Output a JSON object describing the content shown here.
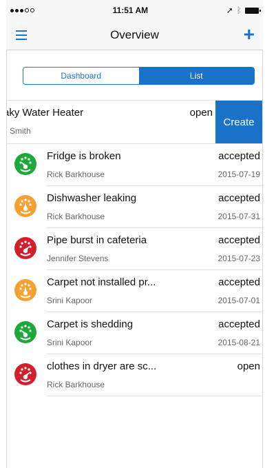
{
  "status_bar": {
    "time": "11:51 AM"
  },
  "nav": {
    "title": "Overview",
    "menu_icon": "hamburger-menu-icon",
    "add_icon": "plus-icon"
  },
  "segmented": {
    "options": [
      "Dashboard",
      "List"
    ],
    "selected": "List"
  },
  "swiped_row": {
    "title": "aky Water Heater",
    "subtitle": "n Smith",
    "status": "open",
    "action": "Create"
  },
  "items": [
    {
      "title": "Fridge is broken",
      "assignee": "Rick Barkhouse",
      "status": "accepted",
      "date": "2015-07-19",
      "priority": "green"
    },
    {
      "title": "Dishwasher leaking",
      "assignee": "Rick Barkhouse",
      "status": "accepted",
      "date": "2015-07-31",
      "priority": "orange"
    },
    {
      "title": "Pipe burst in cafeteria",
      "assignee": "Jennifer Stevens",
      "status": "accepted",
      "date": "2015-07-23",
      "priority": "red"
    },
    {
      "title": "Carpet not installed pr...",
      "assignee": "Srini Kapoor",
      "status": "accepted",
      "date": "2015-07-01",
      "priority": "orange"
    },
    {
      "title": "Carpet is shedding",
      "assignee": "Srini Kapoor",
      "status": "accepted",
      "date": "2015-08-21",
      "priority": "green"
    },
    {
      "title": "clothes in dryer are sc...",
      "assignee": "Rick Barkhouse",
      "status": "open",
      "date": "",
      "priority": "red"
    }
  ],
  "colors": {
    "accent": "#1a73c9",
    "green": "#1fa83a",
    "orange": "#f5a030",
    "red": "#d21f2b"
  }
}
